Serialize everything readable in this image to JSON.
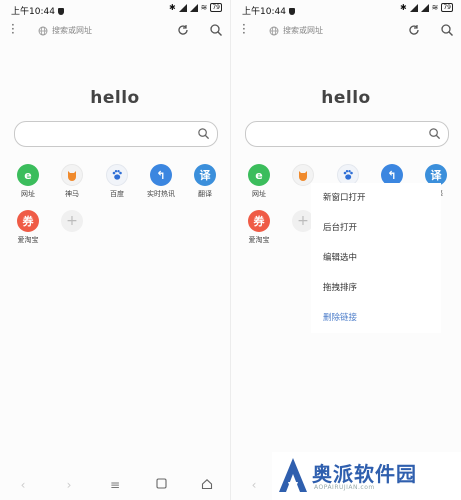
{
  "status": {
    "time": "上午10:44",
    "battery": "79"
  },
  "toolbar": {
    "address_placeholder": "搜索或网址"
  },
  "page": {
    "greeting": "hello"
  },
  "shortcuts": [
    {
      "label": "网址",
      "icon": "e-browser-icon",
      "glyph": "e",
      "color": "#3bbd5c"
    },
    {
      "label": "神马",
      "icon": "shenma-icon",
      "glyph": "",
      "color": "#f08a2c"
    },
    {
      "label": "百度",
      "icon": "baidu-paw-icon",
      "glyph": "",
      "color": "#2f6fd6"
    },
    {
      "label": "实时热讯",
      "icon": "hot-news-icon",
      "glyph": "↰",
      "color": "#3b86e0"
    },
    {
      "label": "翻译",
      "icon": "translate-icon",
      "glyph": "译",
      "color": "#3b8fdb"
    },
    {
      "label": "爱淘宝",
      "icon": "taobao-coupon-icon",
      "glyph": "券",
      "color": "#ef5b46"
    },
    {
      "label": "",
      "icon": "add-shortcut-icon",
      "glyph": "+",
      "color": "#f0f0f0"
    }
  ],
  "right_shortcut_labels": [
    "网址",
    "",
    "",
    "讯",
    "翻译",
    "爱淘宝",
    ""
  ],
  "context_menu": {
    "items": [
      "新窗口打开",
      "后台打开",
      "编辑选中",
      "拖拽排序",
      "删除链接"
    ]
  },
  "brand": {
    "name": "奥派软件园",
    "url": "AOPAIRUJIAN.com"
  }
}
